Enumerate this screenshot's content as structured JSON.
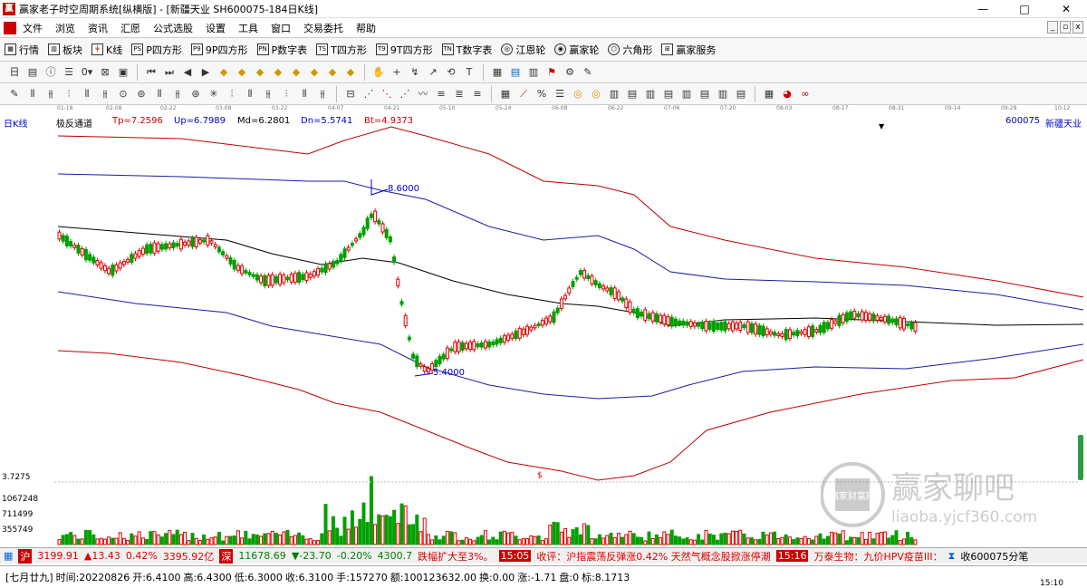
{
  "window": {
    "title": "赢家老子时空周期系统[纵横版] - [新疆天业  SH600075-184日K线]",
    "minimize": "—",
    "maximize": "□",
    "close": "✕"
  },
  "menu": [
    "文件",
    "浏览",
    "资讯",
    "汇愿",
    "公式选股",
    "设置",
    "工具",
    "窗口",
    "交易委托",
    "帮助"
  ],
  "menu_right": [
    "_",
    "▫",
    "x"
  ],
  "toolbar1": [
    {
      "icon": "grid-icon",
      "label": "行情"
    },
    {
      "icon": "blocks-icon",
      "label": "板块"
    },
    {
      "icon": "kline-icon",
      "label": "K线"
    },
    {
      "icon": "p-square-icon",
      "label": "P四方形"
    },
    {
      "icon": "9p-square-icon",
      "label": "9P四方形"
    },
    {
      "icon": "p-number-icon",
      "label": "P数字表"
    },
    {
      "icon": "t-square-icon",
      "label": "T四方形"
    },
    {
      "icon": "9t-square-icon",
      "label": "9T四方形"
    },
    {
      "icon": "t-number-icon",
      "label": "T数字表"
    },
    {
      "icon": "jiangen-wheel-icon",
      "label": "江恩轮"
    },
    {
      "icon": "yingjia-wheel-icon",
      "label": "赢家轮"
    },
    {
      "icon": "hexagon-icon",
      "label": "六角形"
    },
    {
      "icon": "service-icon",
      "label": "赢家服务"
    }
  ],
  "chart": {
    "period_label": "日K线",
    "indicator_name": "极反通道",
    "tp": "Tp=7.2596",
    "up": "Up=6.7989",
    "md": "Md=6.2801",
    "dn": "Dn=5.5741",
    "bt": "Bt=4.9373",
    "stock_code": "600075",
    "stock_name": "新疆天业",
    "high_label": "8.6000",
    "low_label": "5.4000",
    "dollar": "$",
    "volume_axis": [
      "3.7275",
      "1067248",
      "711499",
      "355749"
    ],
    "dates": [
      "01-18",
      "02-08",
      "02-22",
      "03-08",
      "03-22",
      "04-07",
      "04-21",
      "05-10",
      "05-24",
      "06-08",
      "06-22",
      "07-06",
      "07-20",
      "08-03",
      "08-17",
      "08-31",
      "09-14",
      "09-28",
      "10-12"
    ],
    "colors": {
      "up": "#e00000",
      "down": "#00a000",
      "mid": "#000000",
      "inner": "#1c1ca8",
      "outer": "#c00000"
    }
  },
  "status": {
    "sh_index": "3199.91",
    "sh_change": "▲13.43",
    "sh_pct": "0.42%",
    "sh_amount": "3395.92亿",
    "sz_index": "11678.69",
    "sz_change": "▼-23.70",
    "sz_pct": "-0.20%",
    "sz_amount": "4300.7",
    "ticker1": "跌幅扩大至3%。",
    "time1": "15:05",
    "news1": "收评：沪指震荡反弹涨0.42% 天然气概念股掀涨停潮",
    "time2": "15:16",
    "news2": "万泰生物：九价HPV疫苗III：",
    "trade_label": "收600075分笔"
  },
  "bottom": {
    "lunar": "[七月廿九]",
    "time": "时间:20220826",
    "open": "开:6.4100",
    "high": "高:6.4300",
    "low": "低:6.3000",
    "close": "收:6.3100",
    "hands": "手:157270",
    "amount": "额:100123632.00",
    "turnover": "换:0.00",
    "shift": "涨:-1.71",
    "pan": "盘:0",
    "mark": "标:8.1713",
    "clock": "15:10"
  },
  "watermark": {
    "text": "赢家聊吧",
    "url": "liaoba.yjcf360.com",
    "logo": "赢家财富网"
  }
}
